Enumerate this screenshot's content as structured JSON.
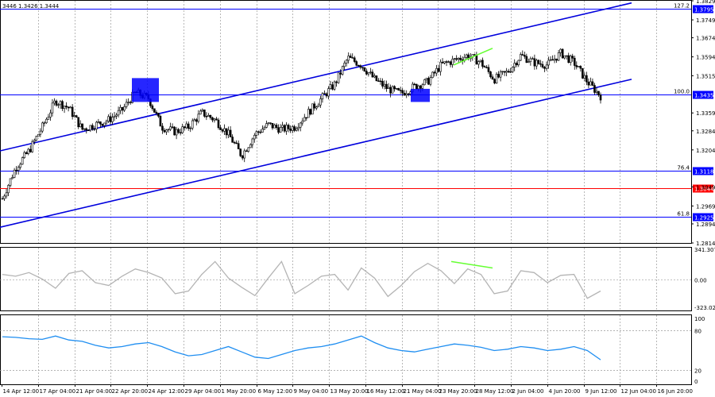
{
  "header": {
    "ohlc_text": "3446 1.3426 1.3444"
  },
  "colors": {
    "channel": "#0000dd",
    "level": "#0000ff",
    "support": "#ff0000",
    "divergence": "#66ff33",
    "cci_line": "#b4b4b4",
    "rsi_line": "#1f8ef1",
    "badge_bg": "#0000ff",
    "support_badge_bg": "#ff0000",
    "grid": "#9a9a9a"
  },
  "levels": {
    "fib_127": {
      "pct": "127.2",
      "price": "1.3795"
    },
    "fib_100": {
      "pct": "100.0",
      "price": "1.3435"
    },
    "fib_76": {
      "pct": "76.4",
      "price": "1.3118"
    },
    "support": {
      "price": "1.3044"
    },
    "fib_61": {
      "pct": "61.8",
      "price": "1.2925"
    }
  },
  "price_axis": [
    "1.3829",
    "1.3749",
    "1.3674",
    "1.3594",
    "1.3515",
    "1.3359",
    "1.3284",
    "1.3204",
    "1.3049",
    "1.2969",
    "1.2894",
    "1.2814"
  ],
  "cci_axis": {
    "top": "341.3079",
    "mid": "0.00",
    "bottom": "-323.021"
  },
  "rsi_axis": {
    "top": "100",
    "upper": "80",
    "lower": "20",
    "bottom": "0"
  },
  "time_labels": [
    "14 Apr 12:00",
    "17 Apr 04:00",
    "21 Apr 04:00",
    "22 Apr 20:00",
    "24 Apr 12:00",
    "29 Apr 04:00",
    "1 May 20:00",
    "6 May 12:00",
    "9 May 04:00",
    "13 May 20:00",
    "16 May 12:00",
    "21 May 04:00",
    "23 May 20:00",
    "28 May 12:00",
    "2 Jun 04:00",
    "4 Jun 20:00",
    "9 Jun 12:00",
    "12 Jun 04:00",
    "16 Jun 20:00"
  ],
  "chart_data": {
    "type": "candlestick",
    "symbol_quote": "3446 1.3426 1.3444",
    "x_labels": [
      "14 Apr 12:00",
      "17 Apr 04:00",
      "21 Apr 04:00",
      "22 Apr 20:00",
      "24 Apr 12:00",
      "29 Apr 04:00",
      "1 May 20:00",
      "6 May 12:00",
      "9 May 04:00",
      "13 May 20:00",
      "16 May 12:00",
      "21 May 04:00",
      "23 May 20:00",
      "28 May 12:00",
      "2 Jun 04:00",
      "4 Jun 20:00",
      "9 Jun 12:00",
      "12 Jun 04:00",
      "16 Jun 20:00"
    ],
    "close_path": [
      1.3,
      1.313,
      1.32,
      1.33,
      1.341,
      1.338,
      1.329,
      1.331,
      1.333,
      1.337,
      1.3445,
      1.342,
      1.33,
      1.328,
      1.33,
      1.336,
      1.333,
      1.327,
      1.318,
      1.327,
      1.331,
      1.329,
      1.33,
      1.336,
      1.342,
      1.348,
      1.359,
      1.356,
      1.35,
      1.346,
      1.344,
      1.347,
      1.349,
      1.356,
      1.358,
      1.36,
      1.357,
      1.35,
      1.353,
      1.36,
      1.357,
      1.356,
      1.361,
      1.357,
      1.349,
      1.343
    ],
    "ylim": [
      1.2814,
      1.3829
    ],
    "channel": {
      "upper": [
        [
          0,
          1.32
        ],
        [
          1,
          1.382
        ]
      ],
      "lower": [
        [
          0,
          1.288
        ],
        [
          1,
          1.35
        ]
      ]
    },
    "horizontal_levels": [
      1.3795,
      1.3435,
      1.3118,
      1.3044,
      1.2925
    ],
    "indicators": {
      "cci": {
        "range": [
          -323.021,
          341.3079
        ],
        "zero": 0.0,
        "values": [
          60,
          40,
          80,
          10,
          -90,
          70,
          100,
          -30,
          -60,
          40,
          120,
          80,
          20,
          -150,
          -120,
          60,
          200,
          20,
          -80,
          -170,
          20,
          200,
          -150,
          -60,
          40,
          60,
          -110,
          130,
          20,
          -180,
          -60,
          90,
          180,
          100,
          -40,
          120,
          60,
          -150,
          -120,
          100,
          80,
          -30,
          50,
          60,
          -200,
          -120
        ]
      },
      "rsi": {
        "range": [
          0,
          100
        ],
        "levels": [
          80,
          20
        ],
        "values": [
          71,
          70,
          68,
          67,
          72,
          66,
          64,
          58,
          54,
          56,
          60,
          62,
          56,
          48,
          42,
          44,
          50,
          56,
          48,
          40,
          38,
          44,
          50,
          54,
          56,
          60,
          66,
          72,
          62,
          54,
          50,
          48,
          52,
          56,
          60,
          58,
          55,
          50,
          52,
          56,
          54,
          50,
          52,
          56,
          50,
          36
        ]
      }
    }
  }
}
